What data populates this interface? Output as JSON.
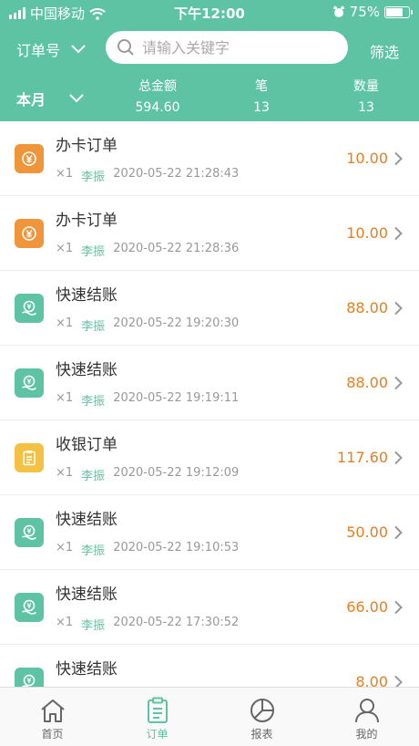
{
  "status_bar": {
    "carrier": "中国移动",
    "time": "下午12:00",
    "battery": "75%"
  },
  "header": {
    "order_type": "订单号",
    "search_placeholder": "请输入关键字",
    "filter": "筛选",
    "period": "本月",
    "stats": [
      {
        "label": "总金额",
        "value": "594.60"
      },
      {
        "label": "笔",
        "value": "13"
      },
      {
        "label": "数量",
        "value": "13"
      }
    ]
  },
  "colors": {
    "primary": "#5dc3a3",
    "amount": "#e67e22",
    "card": "#f0953a",
    "cashier": "#f5c142",
    "quick": "#5dc3a3"
  },
  "orders": [
    {
      "icon": "card",
      "title": "办卡订单",
      "qty": "×1",
      "operator": "李振",
      "time": "2020-05-22 21:28:43",
      "amount": "10.00"
    },
    {
      "icon": "card",
      "title": "办卡订单",
      "qty": "×1",
      "operator": "李振",
      "time": "2020-05-22 21:28:36",
      "amount": "10.00"
    },
    {
      "icon": "quick",
      "title": "快速结账",
      "qty": "×1",
      "operator": "李振",
      "time": "2020-05-22 19:20:30",
      "amount": "88.00"
    },
    {
      "icon": "quick",
      "title": "快速结账",
      "qty": "×1",
      "operator": "李振",
      "time": "2020-05-22 19:19:11",
      "amount": "88.00"
    },
    {
      "icon": "cashier",
      "title": "收银订单",
      "qty": "×1",
      "operator": "李振",
      "time": "2020-05-22 19:12:09",
      "amount": "117.60"
    },
    {
      "icon": "quick",
      "title": "快速结账",
      "qty": "×1",
      "operator": "李振",
      "time": "2020-05-22 19:10:53",
      "amount": "50.00"
    },
    {
      "icon": "quick",
      "title": "快速结账",
      "qty": "×1",
      "operator": "李振",
      "time": "2020-05-22 17:30:52",
      "amount": "66.00"
    },
    {
      "icon": "quick",
      "title": "快速结账",
      "qty": "",
      "operator": "",
      "time": "",
      "amount": "8.00"
    }
  ],
  "tabs": [
    {
      "label": "首页",
      "icon": "home-icon",
      "active": false
    },
    {
      "label": "订单",
      "icon": "clipboard-icon",
      "active": true
    },
    {
      "label": "报表",
      "icon": "pie-chart-icon",
      "active": false
    },
    {
      "label": "我的",
      "icon": "user-icon",
      "active": false
    }
  ]
}
